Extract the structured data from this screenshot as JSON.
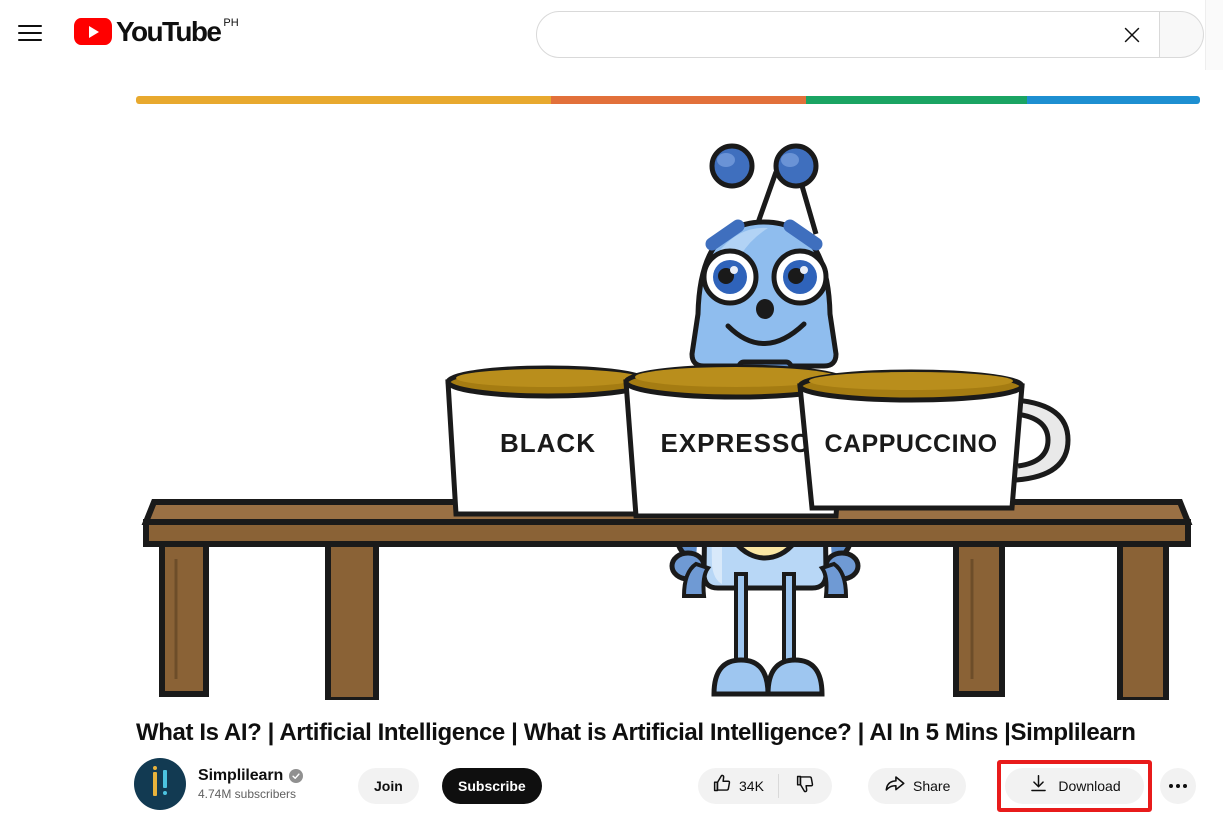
{
  "masthead": {
    "menu_icon": "hamburger-menu-icon",
    "logo_word": "YouTube",
    "logo_country": "PH",
    "play_icon": "youtube-play-icon"
  },
  "search": {
    "value": "",
    "placeholder": "",
    "clear_icon": "close-x-icon",
    "search_icon": "search-icon"
  },
  "player": {
    "progress_segments": [
      {
        "color": "#e8a92e",
        "width_pct": 39.0
      },
      {
        "color": "#e2703a",
        "width_pct": 24.0
      },
      {
        "color": "#1aa463",
        "width_pct": 20.7
      },
      {
        "color": "#1d8fd1",
        "width_pct": 16.3
      }
    ],
    "illustration": {
      "alt": "cartoon robot standing behind a wooden table with three coffee mugs",
      "robot_color": "#8fbdee",
      "table_color": "#8a6236",
      "mugs": [
        {
          "label": "BLACK"
        },
        {
          "label": "EXPRESSO"
        },
        {
          "label": "CAPPUCCINO"
        }
      ],
      "coffee_color": "#a57c12"
    }
  },
  "video": {
    "title": "What Is AI? | Artificial Intelligence | What is Artificial Intelligence? | AI In 5 Mins |Simplilearn"
  },
  "channel": {
    "name": "Simplilearn",
    "verified_icon": "verified-check-icon",
    "subscribers": "4.74M subscribers",
    "avatar_icon": "channel-avatar",
    "avatar_bg": "#123a52"
  },
  "actions": {
    "join_label": "Join",
    "subscribe_label": "Subscribe",
    "like_count": "34K",
    "like_icon": "thumbs-up-icon",
    "dislike_icon": "thumbs-down-icon",
    "share_label": "Share",
    "share_icon": "share-arrow-icon",
    "download_label": "Download",
    "download_icon": "download-arrow-icon",
    "more_icon": "more-horizontal-icon",
    "highlight_color": "#e81b1b"
  }
}
